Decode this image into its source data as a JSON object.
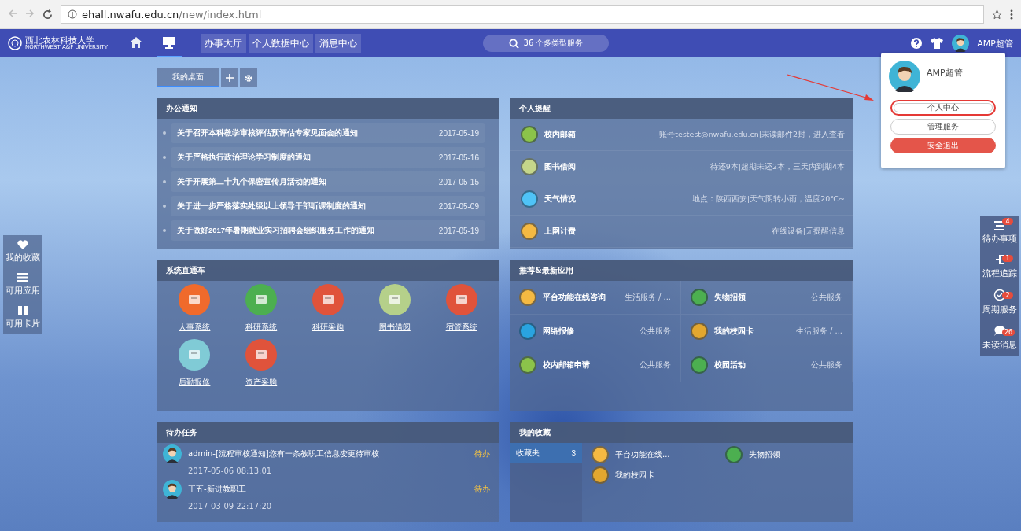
{
  "browser": {
    "url_host": "ehall.nwafu.edu.cn",
    "url_path": "/new/index.html"
  },
  "nav": {
    "logo_cn": "西北农林科技大学",
    "logo_en": "NORTHWEST A&F UNIVERSITY",
    "icon_tabs": [
      {
        "kind": "home",
        "selected": false
      },
      {
        "kind": "desktop",
        "selected": true
      }
    ],
    "menu": [
      "办事大厅",
      "个人数据中心",
      "消息中心"
    ],
    "search": "36 个多类型服务",
    "user": "AMP超管"
  },
  "desk_tabs": [
    {
      "label": "我的桌面",
      "selected": true
    }
  ],
  "notices": {
    "title": "办公通知",
    "items": [
      {
        "title": "关于召开本科教学审核评估预评估专家见面会的通知",
        "date": "2017-05-19"
      },
      {
        "title": "关于严格执行政治理论学习制度的通知",
        "date": "2017-05-16"
      },
      {
        "title": "关于开展第二十九个保密宣传月活动的通知",
        "date": "2017-05-15"
      },
      {
        "title": "关于进一步严格落实处级以上领导干部听课制度的通知",
        "date": "2017-05-09"
      },
      {
        "title": "关于做好2017年暑期就业实习招聘会组织服务工作的通知",
        "date": "2017-05-19"
      }
    ]
  },
  "reminders": {
    "title": "个人提醒",
    "items": [
      {
        "name": "校内邮箱",
        "info": "账号testest@nwafu.edu.cn|未读邮件2封，进入查看",
        "color": "#8bc34a"
      },
      {
        "name": "图书借阅",
        "info": "待还9本|超期未还2本，三天内到期4本",
        "color": "#c5d68a"
      },
      {
        "name": "天气情况",
        "info": "地点：陕西西安|天气阴转小雨，温度20℃~",
        "color": "#4fc3f7"
      },
      {
        "name": "上网计费",
        "info": "在线设备|无提醒信息",
        "color": "#f5b942"
      }
    ]
  },
  "systems": {
    "title": "系统直通车",
    "items": [
      {
        "label": "人事系统",
        "color": "#f06a2c"
      },
      {
        "label": "科研系统",
        "color": "#4caf50"
      },
      {
        "label": "科研采购",
        "color": "#e0533b"
      },
      {
        "label": "图书借阅",
        "color": "#b5d08a"
      },
      {
        "label": "宿管系统",
        "color": "#e0533b"
      },
      {
        "label": "后勤报修",
        "color": "#80cbd6"
      },
      {
        "label": "资产采购",
        "color": "#e0533b"
      }
    ]
  },
  "recommended": {
    "title": "推荐&最新应用",
    "items": [
      {
        "name": "平台功能在线咨询",
        "category": "生活服务 / ...",
        "color": "#f5b942"
      },
      {
        "name": "失物招领",
        "category": "公共服务",
        "color": "#4caf50"
      },
      {
        "name": "网络报修",
        "category": "公共服务",
        "color": "#29a3e0"
      },
      {
        "name": "我的校园卡",
        "category": "生活服务 / ...",
        "color": "#e3a72f"
      },
      {
        "name": "校内邮箱申请",
        "category": "公共服务",
        "color": "#8bc34a"
      },
      {
        "name": "校园活动",
        "category": "公共服务",
        "color": "#4caf50"
      }
    ]
  },
  "todo": {
    "title": "待办任务",
    "items": [
      {
        "text": "admin-[流程审核通知]您有一条教职工信息变更待审核",
        "time": "2017-05-06 08:13:01",
        "status": "待办"
      },
      {
        "text": "王五-新进教职工",
        "time": "2017-03-09 22:17:20",
        "status": "待办"
      }
    ]
  },
  "favorites": {
    "title": "我的收藏",
    "folders": [
      {
        "label": "收藏夹",
        "count": "3",
        "selected": true
      }
    ],
    "items": [
      {
        "name": "平台功能在线...",
        "color": "#f5b942"
      },
      {
        "name": "失物招领",
        "color": "#4caf50"
      },
      {
        "name": "我的校园卡",
        "color": "#e3a72f"
      }
    ]
  },
  "left_dock": [
    {
      "kind": "heart",
      "label": "我的收藏"
    },
    {
      "kind": "list",
      "label": "可用应用"
    },
    {
      "kind": "cards",
      "label": "可用卡片"
    }
  ],
  "right_dock": [
    {
      "kind": "tasks",
      "label": "待办事项",
      "badge": "4"
    },
    {
      "kind": "flow",
      "label": "流程追踪",
      "badge": "1"
    },
    {
      "kind": "check",
      "label": "周期服务",
      "badge": "2"
    },
    {
      "kind": "chat",
      "label": "未读消息",
      "badge": "26"
    }
  ],
  "user_menu": {
    "name": "AMP超管",
    "buttons": [
      {
        "label": "个人中心",
        "kind": "outline",
        "highlighted": true
      },
      {
        "label": "管理服务",
        "kind": "outline",
        "highlighted": false
      },
      {
        "label": "安全退出",
        "kind": "danger",
        "highlighted": false
      }
    ]
  }
}
